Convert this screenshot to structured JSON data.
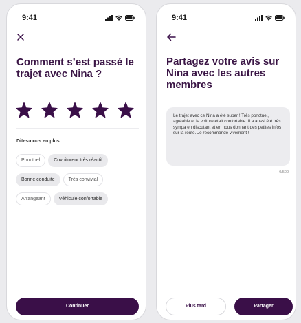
{
  "colors": {
    "accent": "#3a0f48",
    "title": "#3a1545",
    "chip_selected_bg": "#e9e9ec"
  },
  "status_bar": {
    "time": "9:41"
  },
  "rating_screen": {
    "close_icon": "close-icon",
    "title": "Comment s’est passé le trajet avec Nina ?",
    "rating": {
      "value": 5,
      "max": 5,
      "icon": "star-icon"
    },
    "section_label": "Dites-nous en plus",
    "chips": [
      [
        {
          "label": "Ponctuel",
          "selected": false
        },
        {
          "label": "Covoitureur très réactif",
          "selected": true
        }
      ],
      [
        {
          "label": "Bonne conduite",
          "selected": true
        },
        {
          "label": "Très convivial",
          "selected": false
        }
      ],
      [
        {
          "label": "Arrangeant",
          "selected": false
        },
        {
          "label": "Véhicule confortable",
          "selected": true
        }
      ]
    ],
    "continue_label": "Continuer"
  },
  "review_screen": {
    "back_icon": "back-arrow-icon",
    "title": "Partagez votre avis sur Nina avec les autres membres",
    "review_text": "Le trajet avec ce Nina a été super ! Très ponctuel, agréable et la voiture était confortable. Il a aussi été très sympa en discutant et en nous donnant des petites infos sur la route. Je recommande vivement !",
    "counter": "0/500",
    "later_label": "Plus tard",
    "share_label": "Partager"
  }
}
